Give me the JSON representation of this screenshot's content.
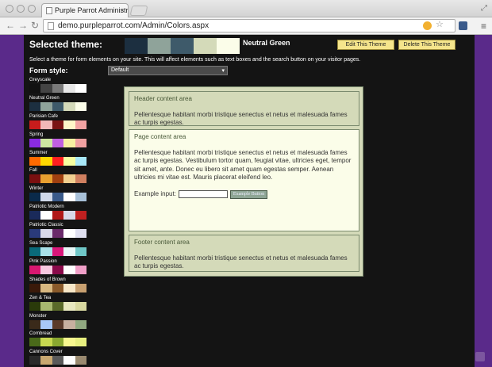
{
  "browser": {
    "tab_title": "Purple Parrot Administrati",
    "url": "demo.purpleparrot.com/Admin/Colors.aspx"
  },
  "header": {
    "selected_label": "Selected theme:",
    "theme_name": "Neutral Green",
    "swatches": [
      "#1c2f40",
      "#8fa39a",
      "#3e5a6a",
      "#d4dab9",
      "#fbfde9"
    ],
    "edit_button": "Edit This Theme",
    "delete_button": "Delete This Theme"
  },
  "description": "Select a theme for form elements on your site. This will affect elements such as text boxes and the search button on your visitor pages.",
  "form_style": {
    "label": "Form style:",
    "selected": "Default"
  },
  "themes": [
    {
      "name": "Greyscale",
      "colors": [
        "#111111",
        "#444444",
        "#7a7a7a",
        "#e8e8e8",
        "#ffffff"
      ]
    },
    {
      "name": "Neutral Green",
      "colors": [
        "#1c2f40",
        "#8fa39a",
        "#3e5a6a",
        "#d4dab9",
        "#fbfde9"
      ]
    },
    {
      "name": "Parisian Cafe",
      "colors": [
        "#c81c1c",
        "#f2b8b8",
        "#7a1414",
        "#fff6c8",
        "#f2a3a3"
      ]
    },
    {
      "name": "Spring",
      "colors": [
        "#8a2be2",
        "#cde8a0",
        "#c060e0",
        "#f7f0a0",
        "#f0a0a0"
      ]
    },
    {
      "name": "Summer",
      "colors": [
        "#ff6a00",
        "#ffd800",
        "#ff2020",
        "#f6ffa0",
        "#a8e8f8"
      ]
    },
    {
      "name": "Fall",
      "colors": [
        "#7a1010",
        "#e8a030",
        "#a04010",
        "#f2d090",
        "#d08060"
      ]
    },
    {
      "name": "Winter",
      "colors": [
        "#0a2a4a",
        "#d0d8e8",
        "#3a5a8a",
        "#ffffff",
        "#a8c0d8"
      ]
    },
    {
      "name": "Patriotic Modern",
      "colors": [
        "#1a2a5a",
        "#ffffff",
        "#b01818",
        "#d8d8e8",
        "#c02020"
      ]
    },
    {
      "name": "Patriotic Classic",
      "colors": [
        "#2a3a7a",
        "#d8d8e8",
        "#6a2a6a",
        "#ffffff",
        "#e0e0f0"
      ]
    },
    {
      "name": "Sea Scape",
      "colors": [
        "#0a6a7a",
        "#a8e0e8",
        "#d8187a",
        "#e8f8f8",
        "#70c8c8"
      ]
    },
    {
      "name": "Pink Passion",
      "colors": [
        "#d81870",
        "#f8c8e0",
        "#8a0a4a",
        "#ffffff",
        "#f0a0c8"
      ]
    },
    {
      "name": "Shades of Brown",
      "colors": [
        "#3a1a0a",
        "#d8b880",
        "#8a5a2a",
        "#f8e8c8",
        "#c8a070"
      ]
    },
    {
      "name": "Zen & Tea",
      "colors": [
        "#2a3a0a",
        "#a8b870",
        "#5a6a2a",
        "#e8e8c0",
        "#d8d8a0"
      ]
    },
    {
      "name": "Monster",
      "colors": [
        "#3a2a1a",
        "#a8c8f8",
        "#5a3a2a",
        "#c8b0a0",
        "#90a880"
      ]
    },
    {
      "name": "Cornbread",
      "colors": [
        "#4a6a1a",
        "#c8d850",
        "#8aa830",
        "#f8f890",
        "#e8f080"
      ]
    },
    {
      "name": "Cannons Cover",
      "colors": [
        "#2a2a2a",
        "#c8a870",
        "#5a5a5a",
        "#ffffff",
        "#9a8a70"
      ]
    }
  ],
  "preview": {
    "header_title": "Header content area",
    "header_text": "Pellentesque habitant morbi tristique senectus et netus et malesuada fames ac turpis egestas.",
    "page_title": "Page content area",
    "page_text": "Pellentesque habitant morbi tristique senectus et netus et malesuada fames ac turpis egestas. Vestibulum tortor quam, feugiat vitae, ultricies eget, tempor sit amet, ante. Donec eu libero sit amet quam egestas semper. Aenean ultricies mi vitae est. Mauris placerat eleifend leo.",
    "example_label": "Example input:",
    "example_button": "Example Button",
    "footer_title": "Footer content area",
    "footer_text": "Pellentesque habitant morbi tristique senectus et netus et malesuada fames ac turpis egestas."
  }
}
